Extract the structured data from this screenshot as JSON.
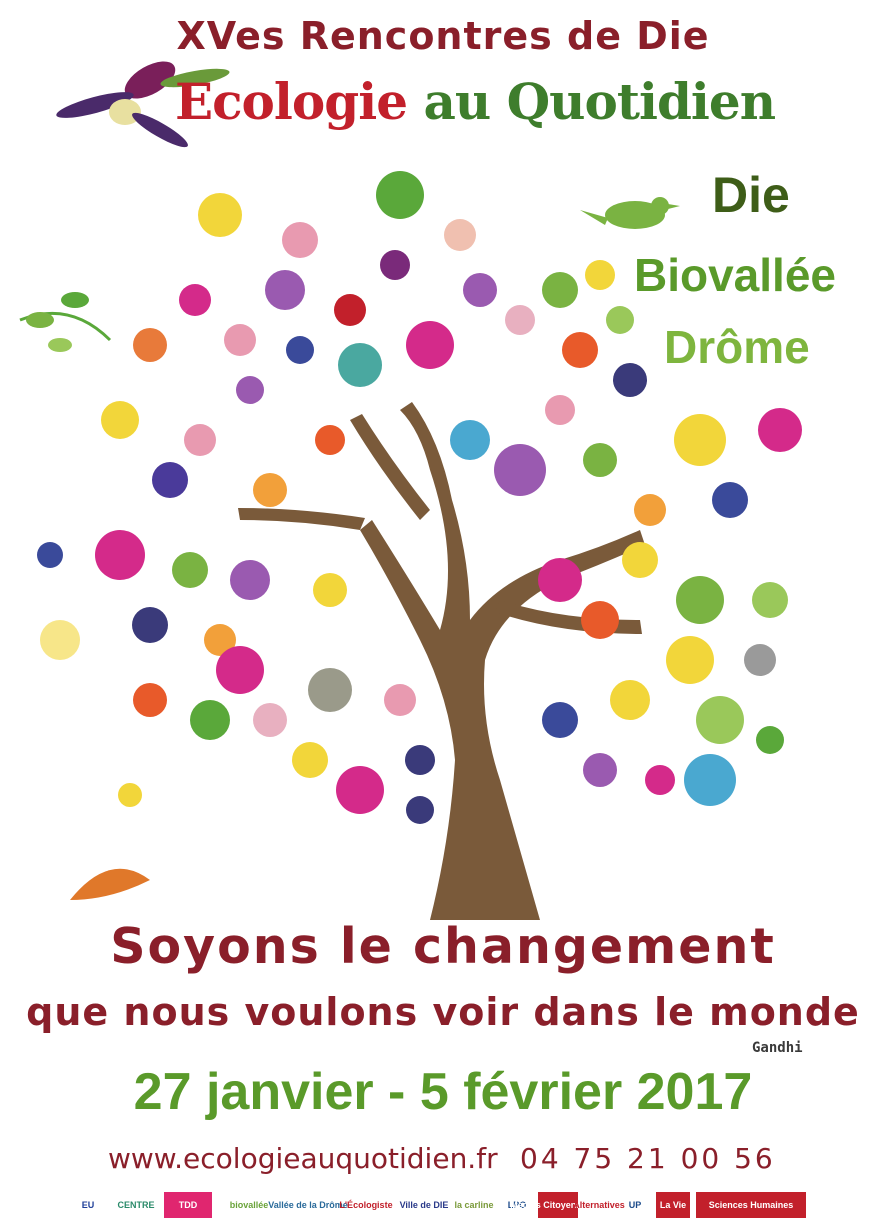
{
  "header": {
    "edition": "XVes Rencontres de Die",
    "brand_part1": "Ecologie",
    "brand_part2": "au Quotidien"
  },
  "places": [
    "Die",
    "Biovallée",
    "Drôme"
  ],
  "tagline": {
    "line1": "Soyons le changement",
    "line2": "que nous voulons voir dans le monde",
    "author": "Gandhi"
  },
  "dates": "27 janvier - 5 février 2017",
  "contact": {
    "website": "www.ecologieauquotidien.fr",
    "phone": "04 75 21 00 56"
  },
  "sponsors": [
    {
      "label": "EU",
      "color": "#1f3f99"
    },
    {
      "label": "CENTRE",
      "color": "#2a8a6a"
    },
    {
      "label": "TDD",
      "color": "#e0266f"
    },
    {
      "label": "biovallée",
      "color": "#6aa33a"
    },
    {
      "label": "Vallée de la Drôme",
      "color": "#2a6a9a"
    },
    {
      "label": "L'Écologiste",
      "color": "#c2202b"
    },
    {
      "label": "Ville de DIE",
      "color": "#2a3a8a"
    },
    {
      "label": "la carline",
      "color": "#7a9a3a"
    },
    {
      "label": "LPO",
      "color": "#1a4a8a"
    },
    {
      "label": "Médias Citoyens Diois",
      "color": "#c2202b"
    },
    {
      "label": "Alternatives",
      "color": "#c2202b"
    },
    {
      "label": "UP",
      "color": "#1a4a8a"
    },
    {
      "label": "La Vie",
      "color": "#c2202b"
    },
    {
      "label": "Sciences Humaines",
      "color": "#c2202b"
    }
  ],
  "colors": {
    "title_red": "#8a1f2a",
    "green_dark": "#3e5d18",
    "green": "#5a9a2a",
    "trunk": "#7a5a3a"
  }
}
